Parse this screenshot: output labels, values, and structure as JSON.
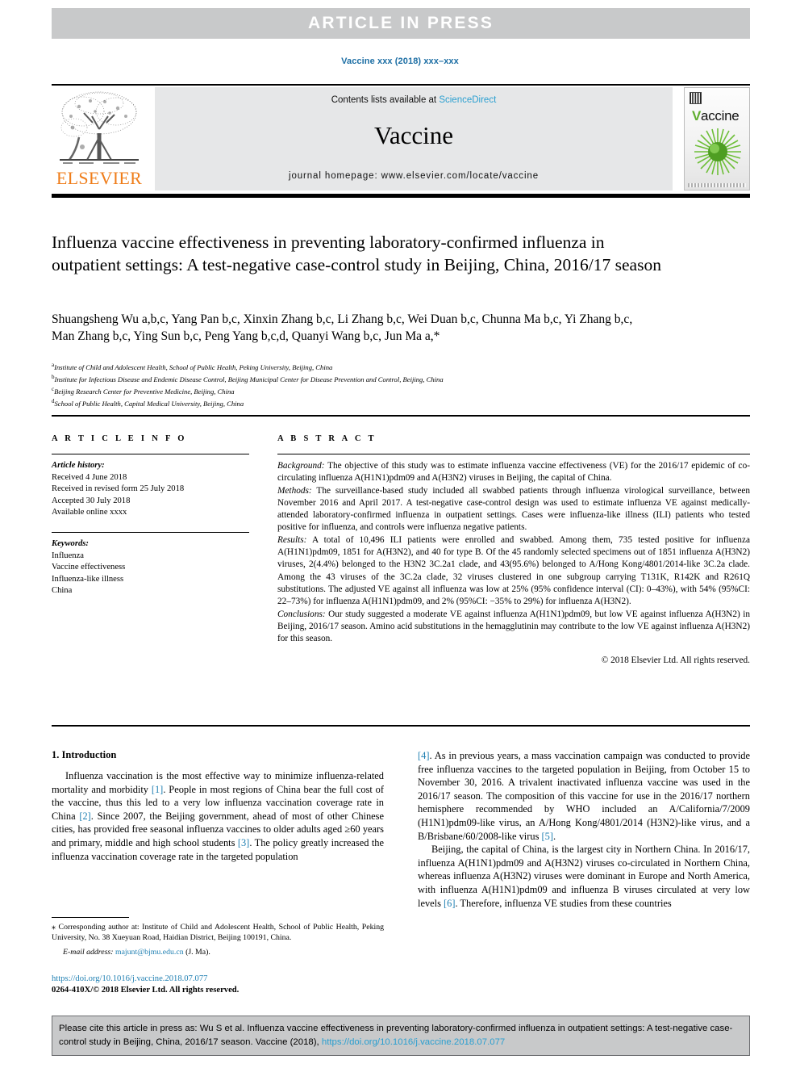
{
  "banner": {
    "label": "ARTICLE  IN  PRESS"
  },
  "journal_ref": "Vaccine xxx (2018) xxx–xxx",
  "masthead": {
    "contents_prefix": "Contents lists available at ",
    "sciencedirect": "ScienceDirect",
    "journal_name": "Vaccine",
    "homepage": "journal homepage: www.elsevier.com/locate/vaccine",
    "publisher": "ELSEVIER",
    "cover_title_initial": "V",
    "cover_title_rest": "accine"
  },
  "article": {
    "title": "Influenza vaccine effectiveness in preventing laboratory-confirmed influenza in outpatient settings: A test-negative case-control study in Beijing, China, 2016/17 season",
    "authors_line1": "Shuangsheng Wu a,b,c, Yang Pan b,c, Xinxin Zhang b,c, Li Zhang b,c, Wei Duan b,c, Chunna Ma b,c, Yi Zhang b,c,",
    "authors_line2": "Man Zhang b,c, Ying Sun b,c, Peng Yang b,c,d, Quanyi Wang b,c, Jun Ma a,*",
    "affiliations": [
      {
        "mark": "a",
        "text": "Institute of Child and Adolescent Health, School of Public Health, Peking University, Beijing, China"
      },
      {
        "mark": "b",
        "text": "Institute for Infectious Disease and Endemic Disease Control, Beijing Municipal Center for Disease Prevention and Control, Beijing, China"
      },
      {
        "mark": "c",
        "text": "Beijing Research Center for Preventive Medicine, Beijing, China"
      },
      {
        "mark": "d",
        "text": "School of Public Health, Capital Medical University, Beijing, China"
      }
    ]
  },
  "article_info": {
    "heading": "A R T I C L E   I N F O",
    "history_label": "Article history:",
    "history": [
      "Received 4 June 2018",
      "Received in revised form 25 July 2018",
      "Accepted 30 July 2018",
      "Available online xxxx"
    ],
    "keywords_label": "Keywords:",
    "keywords": [
      "Influenza",
      "Vaccine effectiveness",
      "Influenza-like illness",
      "China"
    ]
  },
  "abstract": {
    "heading": "A B S T R A C T",
    "background_label": "Background:",
    "background": " The objective of this study was to estimate influenza vaccine effectiveness (VE) for the 2016/17 epidemic of co-circulating influenza A(H1N1)pdm09 and A(H3N2) viruses in Beijing, the capital of China.",
    "methods_label": "Methods:",
    "methods": " The surveillance-based study included all swabbed patients through influenza virological surveillance, between November 2016 and April 2017. A test-negative case-control design was used to estimate influenza VE against medically-attended laboratory-confirmed influenza in outpatient settings. Cases were influenza-like illness (ILI) patients who tested positive for influenza, and controls were influenza negative patients.",
    "results_label": "Results:",
    "results": " A total of 10,496 ILI patients were enrolled and swabbed. Among them, 735 tested positive for influenza A(H1N1)pdm09, 1851 for A(H3N2), and 40 for type B. Of the 45 randomly selected specimens out of 1851 influenza A(H3N2) viruses, 2(4.4%) belonged to the H3N2 3C.2a1 clade, and 43(95.6%) belonged to A/Hong Kong/4801/2014-like 3C.2a clade. Among the 43 viruses of the 3C.2a clade, 32 viruses clustered in one subgroup carrying T131K, R142K and R261Q substitutions. The adjusted VE against all influenza was low at 25% (95% confidence interval (CI): 0–43%), with 54% (95%CI: 22–73%) for influenza A(H1N1)pdm09, and 2% (95%CI: −35% to 29%) for influenza A(H3N2).",
    "conclusions_label": "Conclusions:",
    "conclusions": " Our study suggested a moderate VE against influenza A(H1N1)pdm09, but low VE against influenza A(H3N2) in Beijing, 2016/17 season. Amino acid substitutions in the hemagglutinin may contribute to the low VE against influenza A(H3N2) for this season.",
    "copyright": "© 2018 Elsevier Ltd. All rights reserved."
  },
  "introduction": {
    "heading": "1. Introduction",
    "para1_a": "Influenza vaccination is the most effective way to minimize influenza-related mortality and morbidity ",
    "ref1": "[1]",
    "para1_b": ". People in most regions of China bear the full cost of the vaccine, thus this led to a very low influenza vaccination coverage rate in China ",
    "ref2": "[2]",
    "para1_c": ". Since 2007, the Beijing government, ahead of most of other Chinese cities, has provided free seasonal influenza vaccines to older adults aged ≥60 years and primary, middle and high school students ",
    "ref3": "[3]",
    "para1_d": ". The policy greatly increased the influenza vaccination coverage rate in the targeted population ",
    "ref4": "[4]",
    "para1_e": ". As in previous years, a mass vaccination campaign was conducted to provide free influenza vaccines to the targeted population in Beijing, from October 15 to November 30, 2016. A trivalent inactivated influenza vaccine was used in the 2016/17 season. The composition of this vaccine for use in the 2016/17 northern hemisphere recommended by WHO included an A/California/7/2009 (H1N1)pdm09-like virus, an A/Hong Kong/4801/2014 (H3N2)-like virus, and a B/Brisbane/60/2008-like virus ",
    "ref5": "[5]",
    "para1_f": ".",
    "para2_a": "Beijing, the capital of China, is the largest city in Northern China. In 2016/17, influenza A(H1N1)pdm09 and A(H3N2) viruses co-circulated in Northern China, whereas influenza A(H3N2) viruses were dominant in Europe and North America, with influenza A(H1N1)pdm09 and influenza B viruses circulated at very low levels ",
    "ref6": "[6]",
    "para2_b": ". Therefore, influenza VE studies from these countries"
  },
  "footnote": {
    "star": "⁎",
    "corresponding": " Corresponding author at: Institute of Child and Adolescent Health, School of Public Health, Peking University, No. 38 Xueyuan Road, Haidian District, Beijing 100191, China.",
    "email_label": "E-mail address:",
    "email": "majunt@bjmu.edu.cn",
    "email_suffix": " (J. Ma)."
  },
  "doi_block": {
    "doi": "https://doi.org/10.1016/j.vaccine.2018.07.077",
    "issn": "0264-410X/© 2018 Elsevier Ltd. All rights reserved."
  },
  "cite_box": {
    "text_a": "Please cite this article in press as: Wu S et al. Influenza vaccine effectiveness in preventing laboratory-confirmed influenza in outpatient settings: A test-negative case-control study in Beijing, China, 2016/17 season. Vaccine (2018), ",
    "link": "https://doi.org/10.1016/j.vaccine.2018.07.077"
  },
  "colors": {
    "banner_bg": "#c8c9ca",
    "link_blue": "#2a9fd0",
    "ref_blue": "#1f7fb2",
    "elsevier_orange": "#ef7d1a",
    "masthead_bg": "#e6e7e8",
    "vaccine_green": "#5fae2e"
  }
}
